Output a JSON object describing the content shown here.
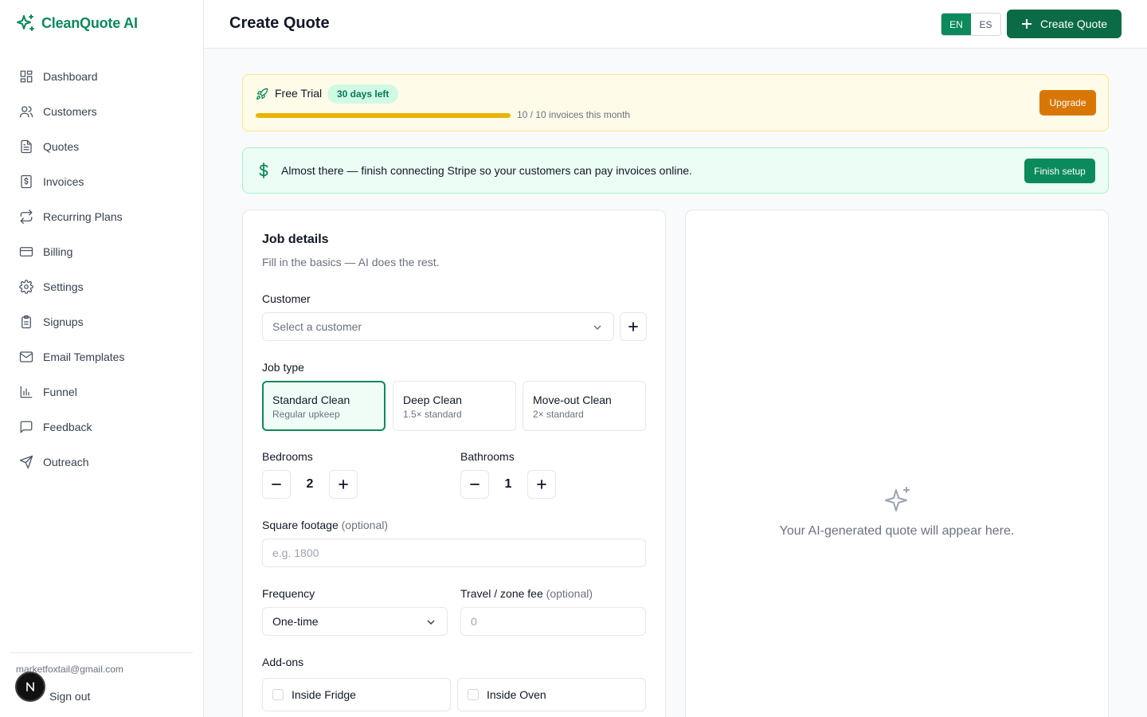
{
  "brand": {
    "name": "CleanQuote AI"
  },
  "sidebar": {
    "items": [
      {
        "label": "Dashboard",
        "icon": "dashboard-icon"
      },
      {
        "label": "Customers",
        "icon": "users-icon"
      },
      {
        "label": "Quotes",
        "icon": "file-text-icon"
      },
      {
        "label": "Invoices",
        "icon": "invoice-icon"
      },
      {
        "label": "Recurring Plans",
        "icon": "repeat-icon"
      },
      {
        "label": "Billing",
        "icon": "credit-card-icon"
      },
      {
        "label": "Settings",
        "icon": "gear-icon"
      },
      {
        "label": "Signups",
        "icon": "clipboard-icon"
      },
      {
        "label": "Email Templates",
        "icon": "mail-icon"
      },
      {
        "label": "Funnel",
        "icon": "bar-chart-icon"
      },
      {
        "label": "Feedback",
        "icon": "message-icon"
      },
      {
        "label": "Outreach",
        "icon": "send-icon"
      }
    ],
    "user_email": "marketfoxtail@gmail.com",
    "signout_label": "Sign out",
    "badge_letter": "N"
  },
  "header": {
    "title": "Create Quote",
    "lang_options": [
      "EN",
      "ES"
    ],
    "lang_selected": "EN",
    "create_label": "Create Quote"
  },
  "trial": {
    "label": "Free Trial",
    "badge": "30 days left",
    "progress_fraction": 1.0,
    "progress_text": "10 / 10 invoices this month",
    "upgrade_label": "Upgrade"
  },
  "stripe": {
    "message": "Almost there — finish connecting Stripe so your customers can pay invoices online.",
    "button_label": "Finish setup"
  },
  "form": {
    "title": "Job details",
    "subtitle": "Fill in the basics — AI does the rest.",
    "customer_label": "Customer",
    "customer_placeholder": "Select a customer",
    "job_type_label": "Job type",
    "job_types": [
      {
        "name": "Standard Clean",
        "desc": "Regular upkeep"
      },
      {
        "name": "Deep Clean",
        "desc": "1.5× standard"
      },
      {
        "name": "Move-out Clean",
        "desc": "2× standard"
      }
    ],
    "selected_job_type": "Standard Clean",
    "bedrooms_label": "Bedrooms",
    "bedrooms_value": "2",
    "bathrooms_label": "Bathrooms",
    "bathrooms_value": "1",
    "sqft_label": "Square footage",
    "optional_text": "(optional)",
    "sqft_placeholder": "e.g. 1800",
    "frequency_label": "Frequency",
    "frequency_value": "One-time",
    "travel_label": "Travel / zone fee",
    "travel_placeholder": "0",
    "addons_label": "Add-ons",
    "addons": [
      "Inside Fridge",
      "Inside Oven"
    ]
  },
  "preview": {
    "message": "Your AI-generated quote will appear here."
  },
  "colors": {
    "brand": "#0b8a5c",
    "brand_dark": "#0b6b47",
    "trial_bg": "#fefbe8",
    "upgrade": "#d97706",
    "stripe_bg": "#ecfdf5"
  }
}
